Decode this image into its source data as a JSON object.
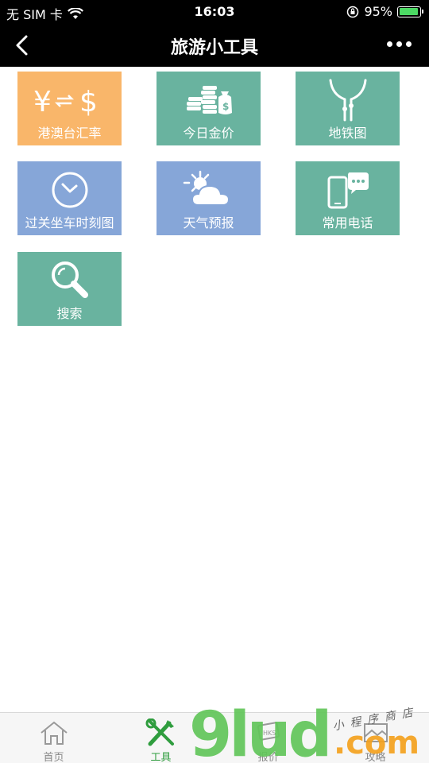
{
  "status_bar": {
    "carrier": "无 SIM 卡",
    "time": "16:03",
    "battery": "95%",
    "battery_level": 0.95
  },
  "nav": {
    "title": "旅游小工具"
  },
  "tiles": [
    {
      "label": "港澳台汇率",
      "icon": "currency-exchange-icon",
      "color": "#f9b66a",
      "symbol": "¥⇌$"
    },
    {
      "label": "今日金价",
      "icon": "gold-coins-icon",
      "color": "#69b39f"
    },
    {
      "label": "地铁图",
      "icon": "metro-map-icon",
      "color": "#69b39f"
    },
    {
      "label": "过关坐车时刻图",
      "icon": "clock-icon",
      "color": "#86a6d8"
    },
    {
      "label": "天气预报",
      "icon": "weather-icon",
      "color": "#86a6d8"
    },
    {
      "label": "常用电话",
      "icon": "phone-chat-icon",
      "color": "#69b39f"
    },
    {
      "label": "搜索",
      "icon": "search-icon",
      "color": "#69b39f"
    }
  ],
  "tab_bar": {
    "items": [
      {
        "label": "首页",
        "icon": "home-icon",
        "active": false
      },
      {
        "label": "工具",
        "icon": "tools-icon",
        "active": true
      },
      {
        "label": "报价",
        "icon": "price-tag-icon",
        "active": false
      },
      {
        "label": "攻略",
        "icon": "guide-icon",
        "active": false
      }
    ],
    "active_color": "#2f9d3e"
  },
  "watermark": {
    "number": "9lud",
    "suffix": ".com",
    "tagline": "小程序商店"
  }
}
